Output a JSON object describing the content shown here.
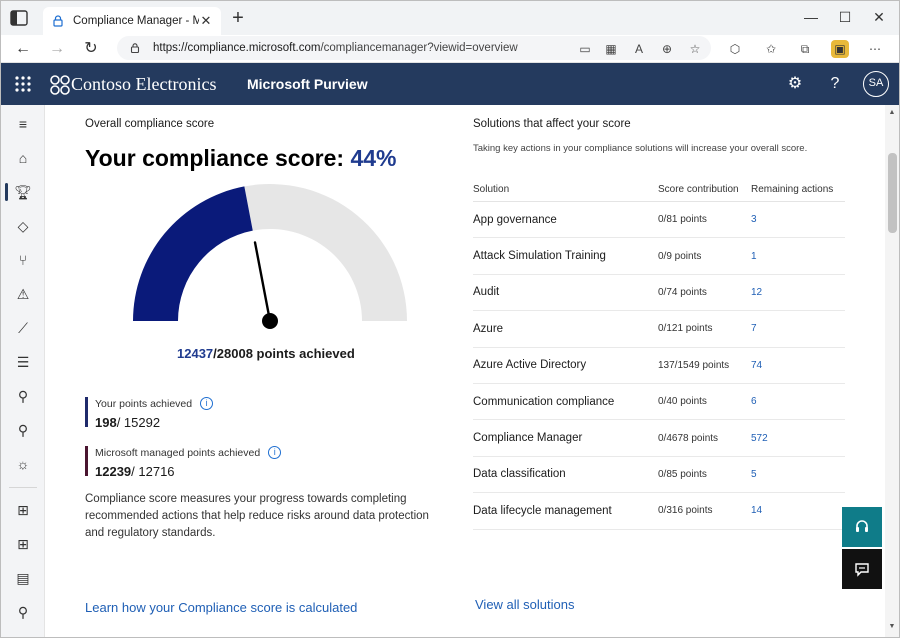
{
  "browser": {
    "tab_title": "Compliance Manager - Microsoft",
    "url_host": "https://compliance.microsoft.com",
    "url_path": "/compliancemanager?viewid=overview"
  },
  "header": {
    "brand": "Contoso Electronics",
    "product": "Microsoft Purview",
    "avatar": "SA"
  },
  "overview": {
    "section_title": "Overall compliance score",
    "heading_prefix": "Your compliance score: ",
    "heading_percent": "44%",
    "score_fraction": 0.44,
    "points_achieved": "12437",
    "points_total": "/28008 points achieved",
    "your_points_label": "Your points achieved",
    "your_points_value": "198",
    "your_points_total": "/ 15292",
    "ms_points_label": "Microsoft managed points achieved",
    "ms_points_value": "12239",
    "ms_points_total": "/ 12716",
    "description": "Compliance score measures your progress towards completing recommended actions that help reduce risks around data protection and regulatory standards.",
    "learn_link": "Learn how your Compliance score is calculated"
  },
  "solutions": {
    "section_title": "Solutions that affect your score",
    "subtitle": "Taking key actions in your compliance solutions will increase your overall score.",
    "columns": [
      "Solution",
      "Score contribution",
      "Remaining actions"
    ],
    "rows": [
      {
        "name": "App governance",
        "score": "0/81 points",
        "actions": "3"
      },
      {
        "name": "Attack Simulation Training",
        "score": "0/9 points",
        "actions": "1"
      },
      {
        "name": "Audit",
        "score": "0/74 points",
        "actions": "12"
      },
      {
        "name": "Azure",
        "score": "0/121 points",
        "actions": "7"
      },
      {
        "name": "Azure Active Directory",
        "score": "137/1549 points",
        "actions": "74"
      },
      {
        "name": "Communication compliance",
        "score": "0/40 points",
        "actions": "6"
      },
      {
        "name": "Compliance Manager",
        "score": "0/4678 points",
        "actions": "572"
      },
      {
        "name": "Data classification",
        "score": "0/85 points",
        "actions": "5"
      },
      {
        "name": "Data lifecycle management",
        "score": "0/316 points",
        "actions": "14"
      }
    ],
    "view_all": "View all solutions"
  },
  "colors": {
    "header_bg": "#243a5e",
    "gauge_fill": "#0a1a7a",
    "gauge_track": "#e6e6e6",
    "your_points_bar": "#1f2a6b",
    "ms_points_bar": "#4a1530",
    "float_primary": "#0f7c89",
    "float_secondary": "#111111"
  },
  "icons": {
    "rail": [
      "hamburger-icon",
      "home-icon",
      "trophy-icon",
      "tag-icon",
      "flow-icon",
      "warning-icon",
      "chart-icon",
      "sliders-icon",
      "search-icon",
      "search-icon",
      "bug-icon",
      "grid-icon",
      "grid-icon",
      "document-search-icon",
      "search-icon"
    ]
  }
}
